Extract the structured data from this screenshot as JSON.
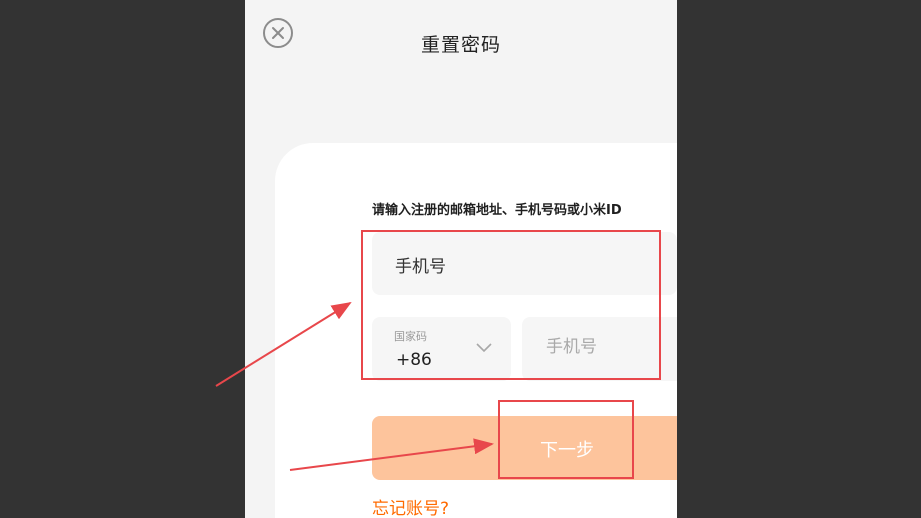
{
  "page": {
    "title": "重置密码"
  },
  "header": {
    "close_icon": "close-circle-icon"
  },
  "form": {
    "instruction": "请输入注册的邮箱地址、手机号码或小米ID",
    "account_type": "手机号",
    "country_code": {
      "label": "国家码",
      "value": "+86",
      "icon": "chevron-down-icon"
    },
    "phone": {
      "placeholder": "手机号",
      "value": ""
    },
    "next_label": "下一步",
    "forgot_account": "忘记账号?"
  },
  "colors": {
    "accent": "#ff6a00",
    "button_bg": "#fdc49c",
    "annotation": "#e8474b",
    "backdrop": "#333333"
  }
}
